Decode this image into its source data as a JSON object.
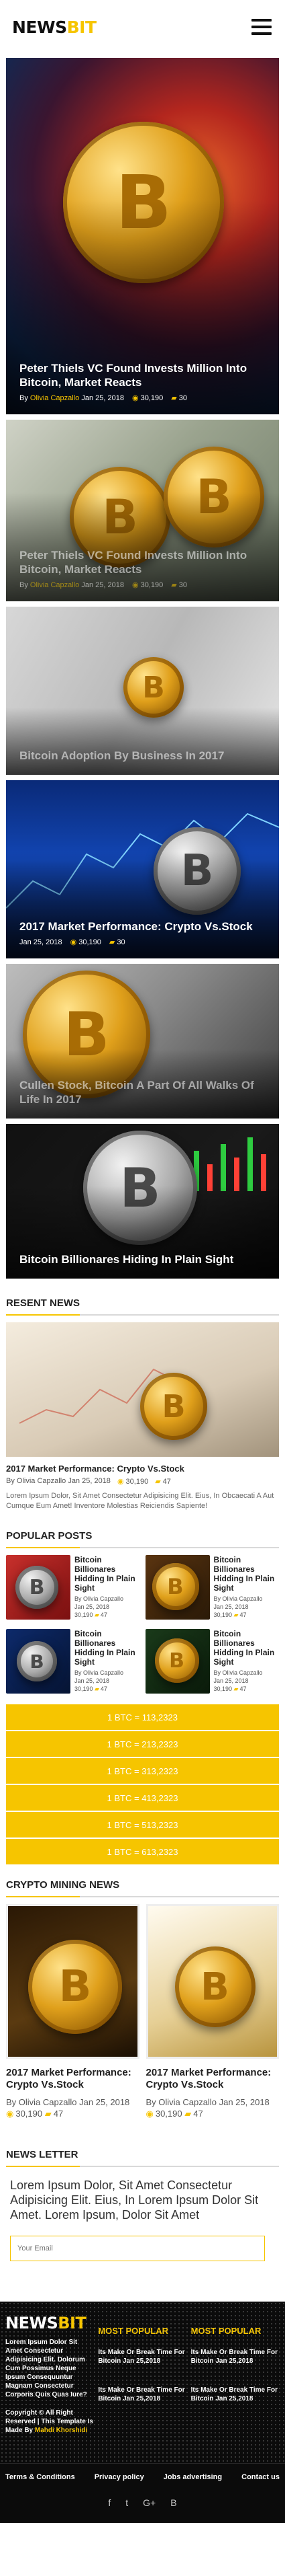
{
  "header": {
    "logo_main": "NEWS",
    "logo_accent": "BIT"
  },
  "hero": [
    {
      "title": "Peter Thiels VC Found Invests Million Into Bitcoin, Market Reacts",
      "byline": "By",
      "author": "Olivia Capzallo",
      "date": "Jan 25, 2018",
      "views": "30,190",
      "comments": "30"
    },
    {
      "title": "Peter Thiels VC Found Invests Million Into Bitcoin, Market Reacts",
      "byline": "By",
      "author": "Olivia Capzallo",
      "date": "Jan 25, 2018",
      "views": "30,190",
      "comments": "30"
    },
    {
      "title": "Bitcoin Adoption By Business In 2017"
    },
    {
      "title": "2017 Market Performance: Crypto Vs.Stock",
      "date": "Jan 25, 2018",
      "views": "30,190",
      "comments": "30"
    },
    {
      "title": "Cullen Stock, Bitcoin A Part Of All Walks Of Life In 2017"
    },
    {
      "title": "Bitcoin Billionares Hiding In Plain Sight"
    }
  ],
  "recent": {
    "heading": "RESENT NEWS",
    "title": "2017 Market Performance: Crypto Vs.Stock",
    "by": "By Olivia Capzallo Jan 25, 2018",
    "views": "30,190",
    "comments": "47",
    "desc": "Lorem Ipsum Dolor, Sit Amet Consectetur Adipisicing Elit. Eius, In Obcaecati A Aut Cumque Eum Amet! Inventore Molestias Reiciendis Sapiente!"
  },
  "popular": {
    "heading": "POPULAR POSTS",
    "items": [
      {
        "title": "Bitcoin Billionares Hidding In Plain Sight",
        "by": "By Olivia Capzallo",
        "date": "Jan 25, 2018",
        "views": "30,190",
        "comments": "47"
      },
      {
        "title": "Bitcoin Billionares Hidding In Plain Sight",
        "by": "By Olivia Capzallo",
        "date": "Jan 25, 2018",
        "views": "30,190",
        "comments": "47"
      },
      {
        "title": "Bitcoin Billionares Hidding In Plain Sight",
        "by": "By Olivia Capzallo",
        "date": "Jan 25, 2018",
        "views": "30,190",
        "comments": "47"
      },
      {
        "title": "Bitcoin Billionares Hidding In Plain Sight",
        "by": "By Olivia Capzallo",
        "date": "Jan 25, 2018",
        "views": "30,190",
        "comments": "47"
      }
    ],
    "rates": [
      "1 BTC = 113,2323",
      "1 BTC = 213,2323",
      "1 BTC = 313,2323",
      "1 BTC = 413,2323",
      "1 BTC = 513,2323",
      "1 BTC = 613,2323"
    ]
  },
  "mining": {
    "heading": "CRYPTO MINING NEWS",
    "items": [
      {
        "title": "2017 Market Performance: Crypto Vs.Stock",
        "by": "By Olivia Capzallo Jan 25, 2018",
        "views": "30,190",
        "comments": "47"
      },
      {
        "title": "2017 Market Performance: Crypto Vs.Stock",
        "by": "By Olivia Capzallo Jan 25, 2018",
        "views": "30,190",
        "comments": "47"
      }
    ]
  },
  "newsletter": {
    "heading": "NEWS LETTER",
    "text": "Lorem Ipsum Dolor, Sit Amet Consectetur Adipisicing Elit. Eius, In Lorem Ipsum Dolor Sit Amet. Lorem Ipsum, Dolor Sit Amet",
    "placeholder": "Your Email"
  },
  "footer": {
    "logo_main": "NEWS",
    "logo_accent": "BIT",
    "desc": "Lorem Ipsum Dolor Sit Amet Consectetur Adipisicing Elit. Dolorum Cum Possimus Neque Ipsum Consequuntur Magnam Consectetur Corporis Quis Quas Iure?",
    "copy": "Copyright © All Right Reserved | This Template Is Made By",
    "maker": "Mahdi Khorshidi",
    "col1": {
      "heading": "MOST POPULAR",
      "items": [
        "Its Make Or Break Time For Bitcoin Jan 25,2018",
        "Its Make Or Break Time For Bitcoin Jan 25,2018"
      ]
    },
    "col2": {
      "heading": "MOST POPULAR",
      "items": [
        "Its Make Or Break Time For Bitcoin Jan 25,2018",
        "Its Make Or Break Time For Bitcoin Jan 25,2018"
      ]
    },
    "links": [
      "Terms & Conditions",
      "Privacy policy",
      "Jobs advertising",
      "Contact us"
    ],
    "social": [
      "f",
      "t",
      "G+",
      "B"
    ]
  },
  "icons": {
    "views": "eye-icon",
    "comments": "comment-icon"
  },
  "colors": {
    "accent": "#f6c500",
    "footer_bg": "#0b0b0b"
  }
}
